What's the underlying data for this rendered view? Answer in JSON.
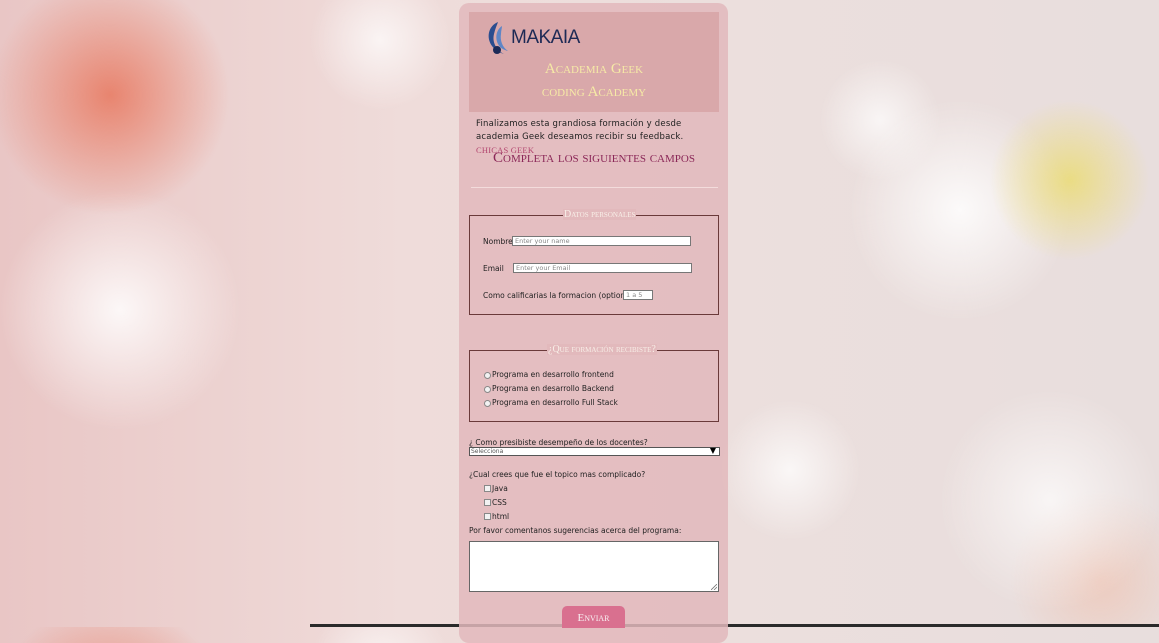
{
  "header": {
    "logo_text": "MAKAIA",
    "line1": "Academia Geek",
    "line2": "coding Academy"
  },
  "intro": {
    "text": "Finalizamos esta grandiosa formación y desde academia Geek deseamos recibir su feedback.",
    "highlight": "CHICAS GEEK"
  },
  "subtitle": "Completa los siguientes campos",
  "personal": {
    "legend": "Datos personales",
    "name_label": "Nombre",
    "name_placeholder": "Enter your name",
    "email_label": "Email",
    "email_placeholder": "Enter your Email",
    "rating_label": "Como calificarias la formacion (optional)",
    "rating_placeholder": "1 a 5"
  },
  "training": {
    "legend": "¿Que formación recibiste?",
    "options": [
      "Programa en desarrollo frontend",
      "Programa en desarrollo Backend",
      "Programa en desarrollo Full Stack"
    ]
  },
  "teachers": {
    "question": "¿ Como presibiste desempeño de los docentes?",
    "selected": "Selecciona"
  },
  "topics": {
    "question": "¿Cual crees que fue el topico mas complicado?",
    "options": [
      "Java",
      "CSS",
      "html"
    ]
  },
  "comments": {
    "label": "Por favor comentanos sugerencias acerca del programa:"
  },
  "submit_label": "Enviar",
  "colors": {
    "header_bg": "#d9a8aa",
    "accent": "#8b2858",
    "button": "#d9708f",
    "brand_text": "#f6eaa6"
  }
}
